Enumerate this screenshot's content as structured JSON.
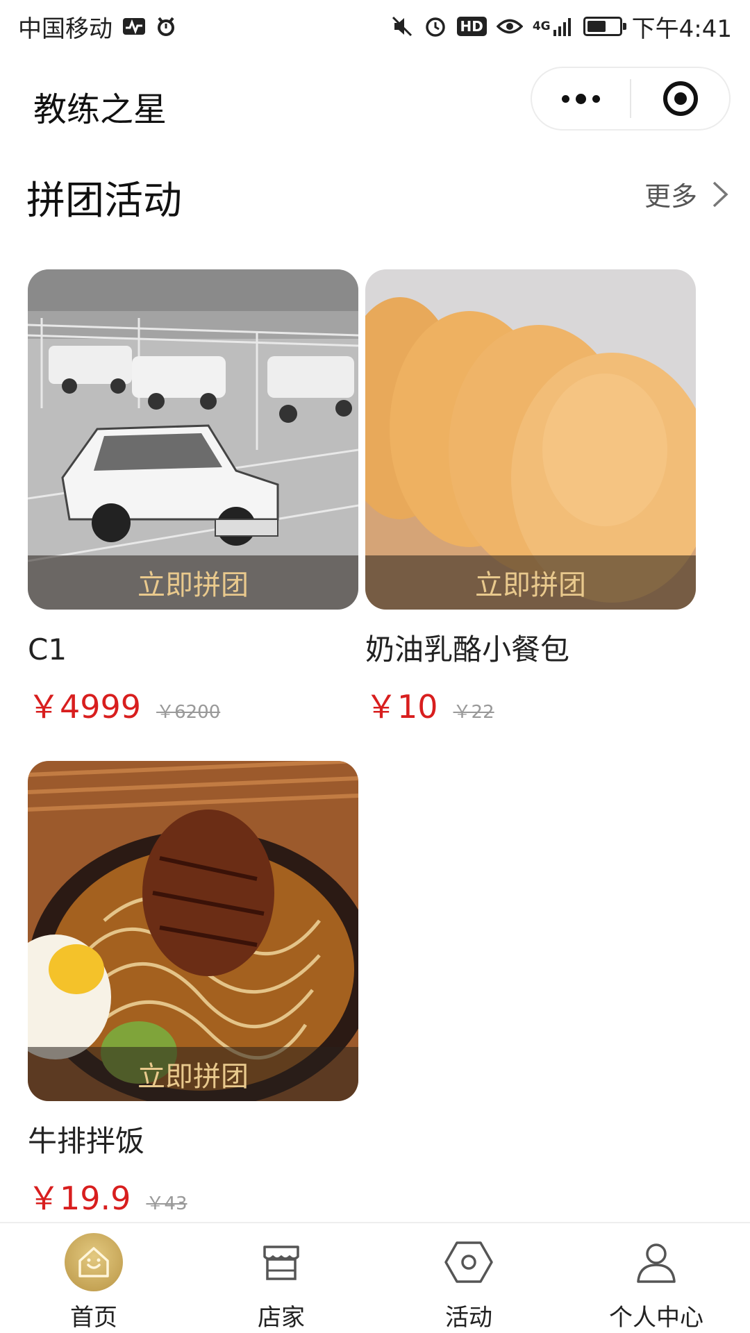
{
  "status_bar": {
    "carrier": "中国移动",
    "network": "4G",
    "time": "下午4:41",
    "hd_badge": "HD",
    "battery_level": 0.6
  },
  "nav": {
    "title": "教练之星"
  },
  "section": {
    "title": "拼团活动",
    "more_label": "更多"
  },
  "products": [
    {
      "name": "C1",
      "price": "￥4999",
      "original_price": "￥6200",
      "join_label": "立即拼团",
      "image": "driving-school-cars-photo"
    },
    {
      "name": "奶油乳酪小餐包",
      "price": "￥10",
      "original_price": "￥22",
      "join_label": "立即拼团",
      "image": "bread-rolls-photo"
    },
    {
      "name": "牛排拌饭",
      "price": "￥19.9",
      "original_price": "￥43",
      "join_label": "立即拼团",
      "image": "steak-noodles-photo"
    }
  ],
  "tab_bar": {
    "items": [
      {
        "label": "首页",
        "icon": "home-icon",
        "active": true
      },
      {
        "label": "店家",
        "icon": "store-icon",
        "active": false
      },
      {
        "label": "活动",
        "icon": "activity-hexagon-icon",
        "active": false
      },
      {
        "label": "个人中心",
        "icon": "user-icon",
        "active": false
      }
    ]
  },
  "colors": {
    "price_red": "#d81e1e",
    "join_text_gold": "#e9c98d",
    "active_tab_gold": "#c9a95a"
  }
}
